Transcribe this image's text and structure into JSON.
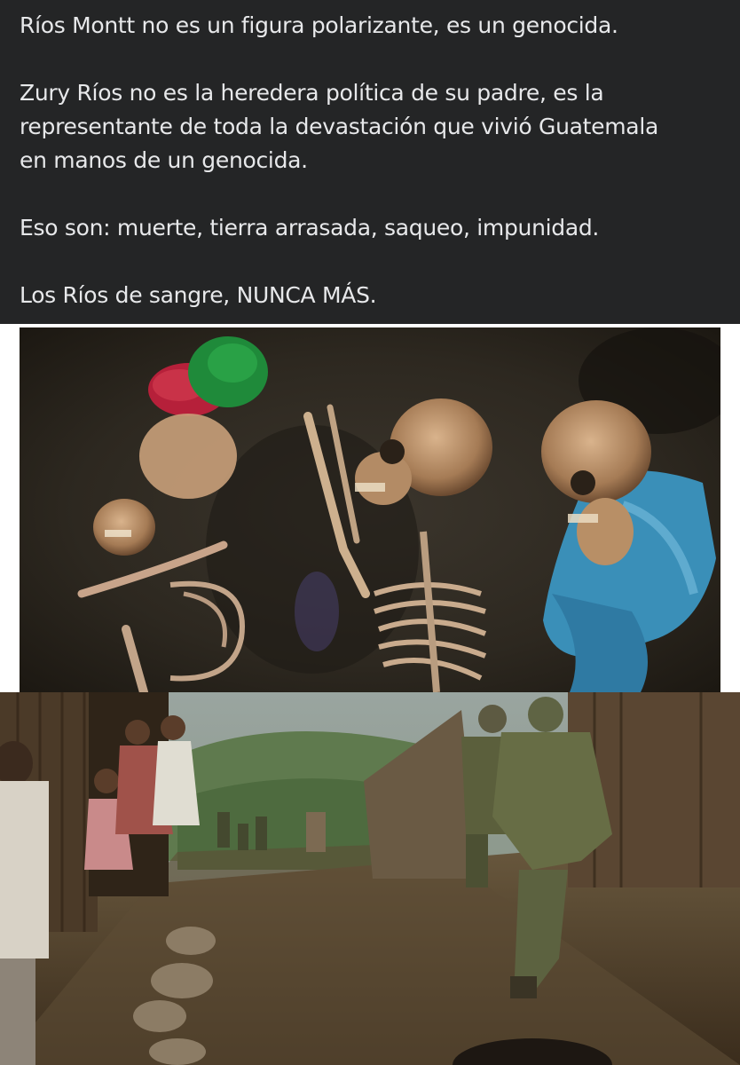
{
  "post": {
    "paragraphs": [
      "Ríos Montt no es un figura polarizante, es un genocida.",
      "Zury Ríos no es la heredera política de su padre, es la representante de toda la devastación que vivió Guatemala en manos de un genocida.",
      "Eso son: muerte, tierra arrasada, saqueo, impunidad.",
      "Los Ríos de sangre, NUNCA MÁS."
    ],
    "line_breaks": {
      "p2_line1": "Zury Ríos no es la heredera política de su padre, es la",
      "p2_line2": "representante de toda la devastación que vivió Guatemala",
      "p2_line3": "en manos de un genocida."
    }
  },
  "colors": {
    "text_background": "#242526",
    "text_color": "#e7e8ea",
    "frame_background": "#ffffff"
  },
  "images": [
    {
      "name": "exhumation-photo"
    },
    {
      "name": "village-soldiers-photo"
    }
  ]
}
